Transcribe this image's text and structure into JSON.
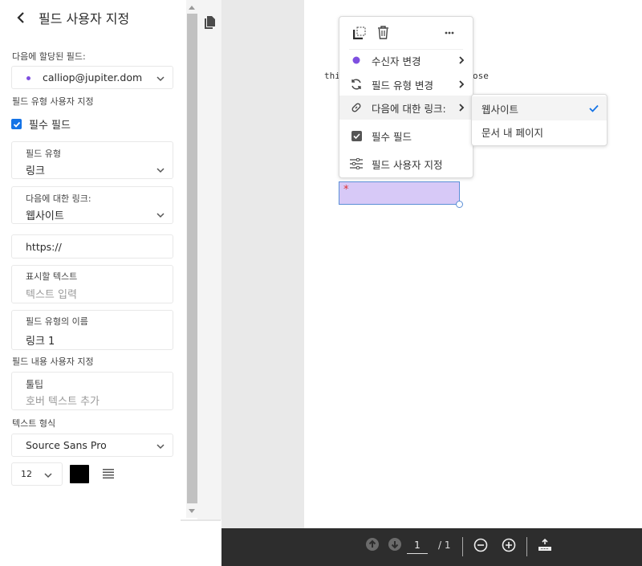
{
  "panel": {
    "title": "필드 사용자 지정",
    "assigned_label": "다음에 할당된 필드:",
    "assigned_value": "calliop@jupiter.dom",
    "assigned_dot_color": "#7e4fe0",
    "field_type_section": "필드 유형 사용자 지정",
    "required_checkbox": {
      "label": "필수 필드",
      "checked": true
    },
    "field_type": {
      "label": "필드 유형",
      "value": "링크"
    },
    "link_to": {
      "label": "다음에 대한 링크:",
      "value": "웹사이트"
    },
    "url_input": {
      "value": "https://"
    },
    "display_text": {
      "label": "표시할 텍스트",
      "placeholder": "텍스트 입력"
    },
    "field_name": {
      "label": "필드 유형의 이름",
      "value": "링크 1"
    },
    "content_section": "필드 내용 사용자 지정",
    "tooltip": {
      "label": "툴팁",
      "placeholder": "호버 텍스트 추가"
    },
    "text_format_section": "텍스트 형식",
    "font": {
      "value": "Source Sans Pro"
    },
    "font_size": {
      "value": "12"
    },
    "text_color": "#000000"
  },
  "document": {
    "text_left": "thi",
    "text_right": "ose"
  },
  "context_menu": {
    "items": [
      {
        "label": "수신자 변경",
        "icon": "recipient-dot-icon",
        "submenu": true
      },
      {
        "label": "필드 유형 변경",
        "icon": "refresh-icon",
        "submenu": true
      },
      {
        "label": "다음에 대한 링크:",
        "icon": "link-icon",
        "submenu": true
      },
      {
        "label": "필수 필드",
        "icon": "checkbox-icon",
        "submenu": false
      },
      {
        "label": "필드 사용자 지정",
        "icon": "sliders-icon",
        "submenu": false
      }
    ],
    "submenu_items": [
      {
        "label": "웹사이트",
        "selected": true
      },
      {
        "label": "문서 내 페이지",
        "selected": false
      }
    ]
  },
  "field": {
    "required_marker": "*"
  },
  "bottombar": {
    "current_page": "1",
    "total_pages": "/ 1"
  }
}
